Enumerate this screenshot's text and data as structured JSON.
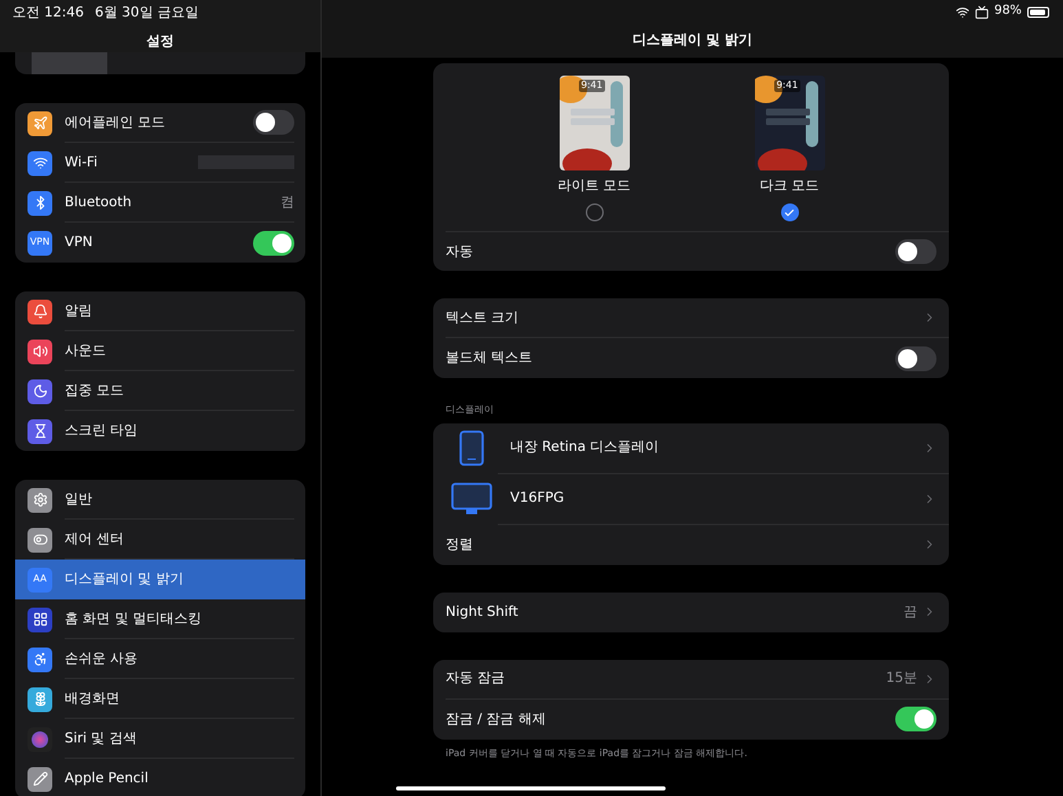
{
  "status_bar": {
    "time": "오전 12:46",
    "date": "6월 30일 금요일",
    "battery": "98%"
  },
  "sidebar": {
    "title": "설정",
    "groups": [
      [
        {
          "label": "에어플레인 모드",
          "kind": "toggle",
          "on": false,
          "color": "#f09a37",
          "selected": false
        },
        {
          "label": "Wi-Fi",
          "kind": "hidden",
          "color": "#3478f6",
          "selected": false
        },
        {
          "label": "Bluetooth",
          "kind": "value",
          "value": "켬",
          "color": "#3478f6",
          "selected": false
        },
        {
          "label": "VPN",
          "kind": "toggle",
          "on": true,
          "icon_text": "VPN",
          "color": "#3478f6",
          "selected": false
        }
      ],
      [
        {
          "label": "알림",
          "kind": "plain",
          "color": "#eb4d3d",
          "selected": false
        },
        {
          "label": "사운드",
          "kind": "plain",
          "color": "#eb445a",
          "selected": false
        },
        {
          "label": "집중 모드",
          "kind": "plain",
          "color": "#5e5ce6",
          "selected": false
        },
        {
          "label": "스크린 타임",
          "kind": "plain",
          "color": "#5e5ce6",
          "selected": false
        }
      ],
      [
        {
          "label": "일반",
          "kind": "plain",
          "color": "#8e8e93",
          "selected": false
        },
        {
          "label": "제어 센터",
          "kind": "plain",
          "color": "#8e8e93",
          "selected": false
        },
        {
          "label": "디스플레이 및 밝기",
          "kind": "plain",
          "icon_text": "AA",
          "color": "#3478f6",
          "selected": true
        },
        {
          "label": "홈 화면 및 멀티태스킹",
          "kind": "plain",
          "color": "#2c3fc4",
          "selected": false
        },
        {
          "label": "손쉬운 사용",
          "kind": "plain",
          "color": "#3478f6",
          "selected": false
        },
        {
          "label": "배경화면",
          "kind": "plain",
          "color": "#35aadc",
          "selected": false
        },
        {
          "label": "Siri 및 검색",
          "kind": "plain",
          "color": "#222222",
          "selected": false
        },
        {
          "label": "Apple Pencil",
          "kind": "plain",
          "color": "#8e8e93",
          "selected": false
        }
      ]
    ]
  },
  "detail": {
    "title": "디스플레이 및 밝기",
    "appearance": {
      "options": [
        {
          "label": "라이트 모드",
          "time": "9:41",
          "kind": "light",
          "selected": false
        },
        {
          "label": "다크 모드",
          "time": "9:41",
          "kind": "dark",
          "selected": true
        }
      ],
      "auto": {
        "label": "자동",
        "on": false
      }
    },
    "groups": [
      {
        "rows": [
          {
            "kind": "chevron",
            "label": "텍스트 크기"
          },
          {
            "kind": "toggle",
            "label": "볼드체 텍스트",
            "on": false
          }
        ]
      },
      {
        "header": "디스플레이",
        "rows": [
          {
            "kind": "tablet",
            "label": "내장 Retina 디스플레이"
          },
          {
            "kind": "monitor",
            "label": "V16FPG"
          },
          {
            "kind": "chevron",
            "label": "정렬"
          }
        ]
      },
      {
        "rows": [
          {
            "kind": "chevron",
            "label": "Night Shift",
            "value": "끔"
          }
        ]
      },
      {
        "rows": [
          {
            "kind": "chevron",
            "label": "자동 잠금",
            "value": "15분"
          },
          {
            "kind": "toggle",
            "label": "잠금 / 잠금 해제",
            "on": true
          }
        ],
        "footer": "iPad 커버를 닫거나 열 때 자동으로 iPad를 잠그거나 잠금 해제합니다."
      }
    ]
  }
}
